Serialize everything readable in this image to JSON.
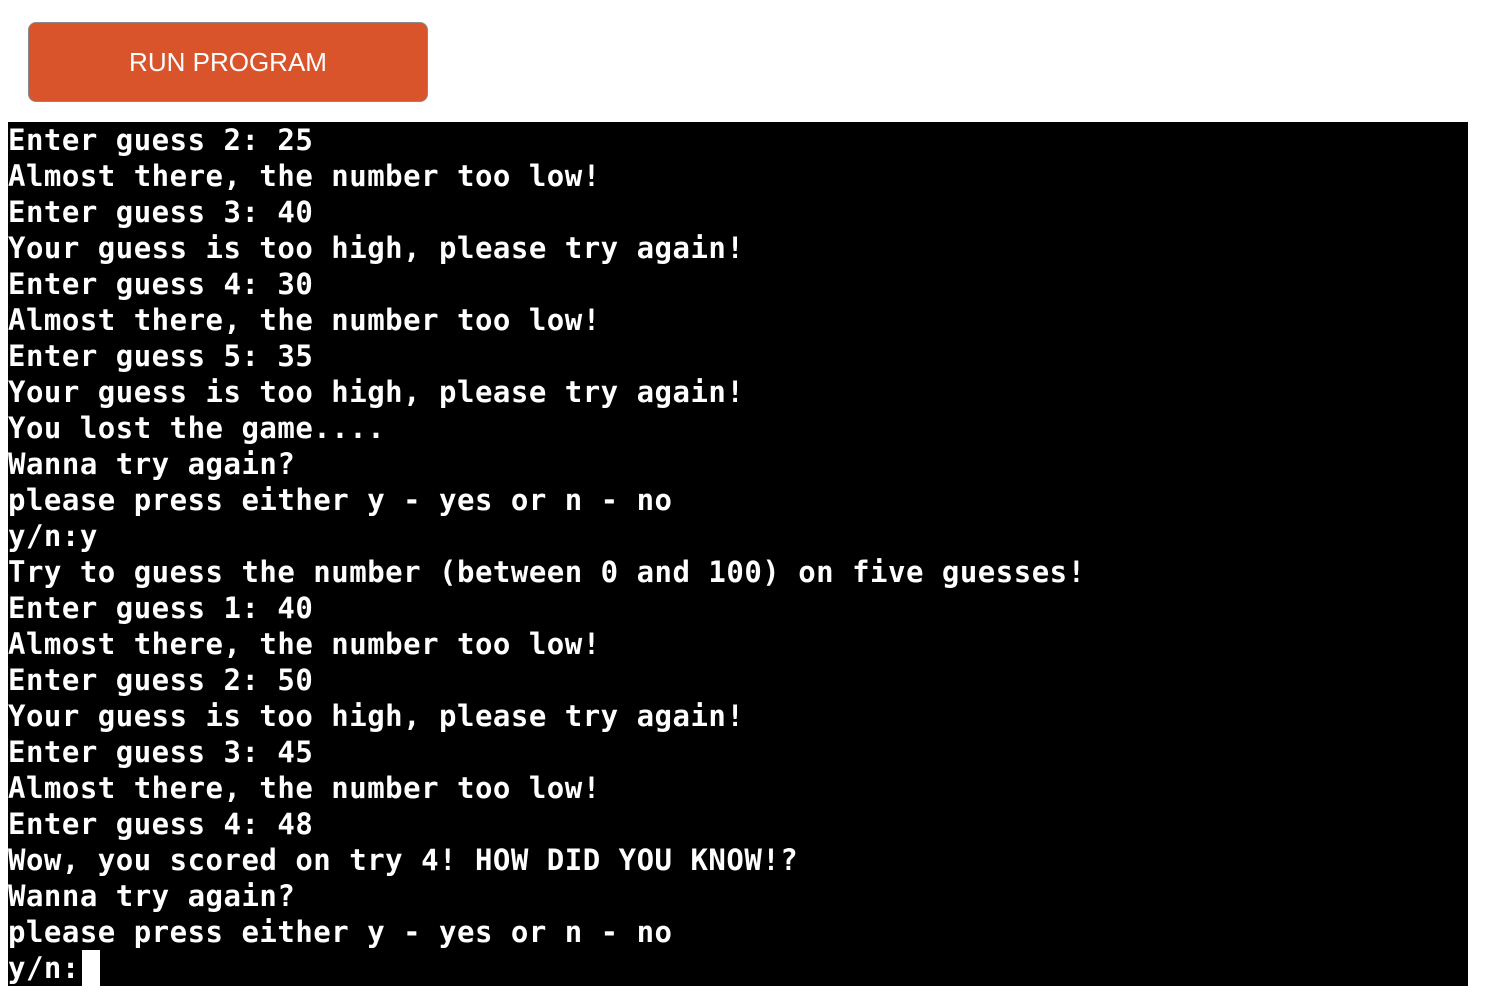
{
  "toolbar": {
    "run_label": "RUN PROGRAM"
  },
  "terminal": {
    "lines": [
      "Enter guess 2: 25",
      "Almost there, the number too low!",
      "Enter guess 3: 40",
      "Your guess is too high, please try again!",
      "Enter guess 4: 30",
      "Almost there, the number too low!",
      "Enter guess 5: 35",
      "Your guess is too high, please try again!",
      "You lost the game....",
      "Wanna try again?",
      "please press either y - yes or n - no",
      "y/n:y",
      "Try to guess the number (between 0 and 100) on five guesses!",
      "Enter guess 1: 40",
      "Almost there, the number too low!",
      "Enter guess 2: 50",
      "Your guess is too high, please try again!",
      "Enter guess 3: 45",
      "Almost there, the number too low!",
      "Enter guess 4: 48",
      "Wow, you scored on try 4! HOW DID YOU KNOW!?",
      "Wanna try again?",
      "please press either y - yes or n - no"
    ],
    "prompt": "y/n:"
  },
  "colors": {
    "button_bg": "#d9532b",
    "terminal_bg": "#000000",
    "terminal_fg": "#ffffff"
  }
}
